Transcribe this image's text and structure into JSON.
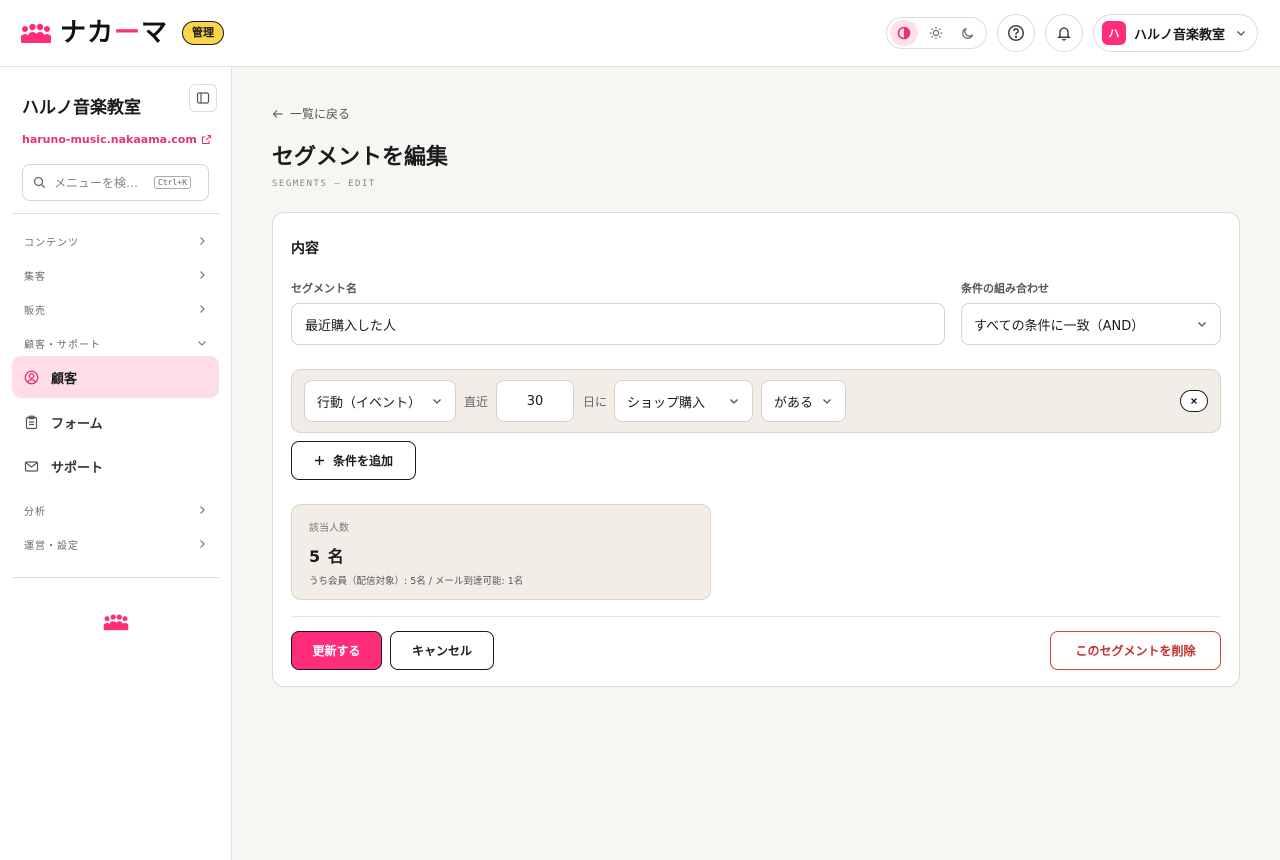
{
  "brand": {
    "logo_text_a": "ナカ",
    "logo_text_dash": "ー",
    "logo_text_b": "マ",
    "admin_badge": "管理",
    "accent_color": "#ff2d7a"
  },
  "header": {
    "theme_options": [
      "contrast-icon",
      "sun-icon",
      "moon-icon"
    ],
    "account_avatar": "ハ",
    "account_name": "ハルノ音楽教室"
  },
  "sidebar": {
    "title": "ハルノ音楽教室",
    "url": "haruno-music.nakaama.com",
    "search_placeholder": "メニューを検…",
    "search_shortcut": "Ctrl+K",
    "groups": [
      {
        "label": "コンテンツ",
        "expanded": false
      },
      {
        "label": "集客",
        "expanded": false
      },
      {
        "label": "販売",
        "expanded": false
      },
      {
        "label": "顧客・サポート",
        "expanded": true
      },
      {
        "label": "分析",
        "expanded": false
      },
      {
        "label": "運営・設定",
        "expanded": false
      }
    ],
    "items": [
      {
        "label": "顧客",
        "icon": "user-circle-icon",
        "active": true
      },
      {
        "label": "フォーム",
        "icon": "clipboard-icon",
        "active": false
      },
      {
        "label": "サポート",
        "icon": "mail-icon",
        "active": false
      }
    ]
  },
  "page": {
    "back_label": "一覧に戻る",
    "title": "セグメントを編集",
    "subtitle": "SEGMENTS — EDIT"
  },
  "form": {
    "section_title": "内容",
    "name_label": "セグメント名",
    "name_value": "最近購入した人",
    "combine_label": "条件の組み合わせ",
    "combine_value": "すべての条件に一致（AND）",
    "condition": {
      "type": "行動（イベント）",
      "prefix": "直近",
      "days": "30",
      "suffix": "日に",
      "event": "ショップ購入",
      "presence": "がある"
    },
    "add_condition_label": "条件を追加",
    "stats": {
      "label": "該当人数",
      "count": "5 名",
      "note": "うち会員（配信対象）: 5名 / メール到達可能: 1名"
    },
    "update_label": "更新する",
    "cancel_label": "キャンセル",
    "delete_label": "このセグメントを削除"
  }
}
